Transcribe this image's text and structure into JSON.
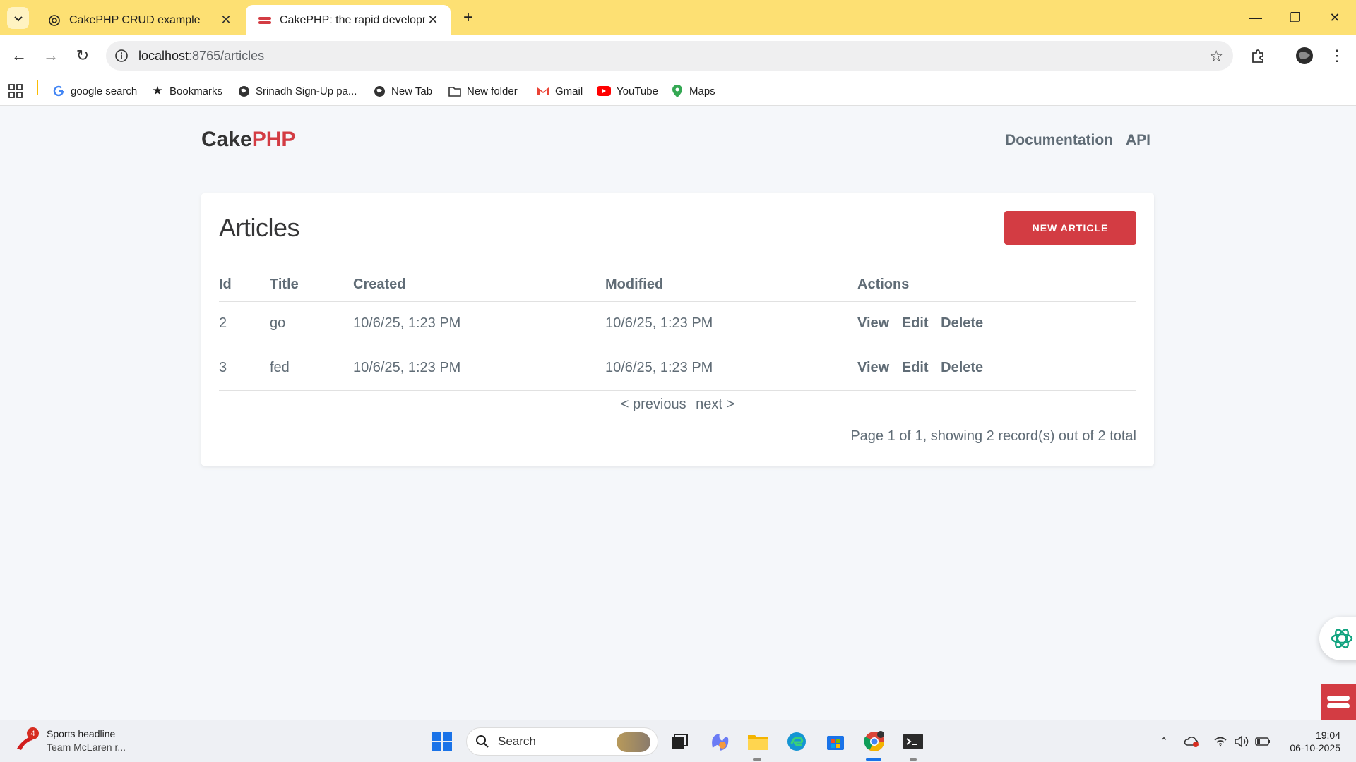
{
  "browser": {
    "tabs": [
      {
        "title": "CakePHP CRUD example",
        "active": false
      },
      {
        "title": "CakePHP: the rapid developme",
        "active": true
      }
    ],
    "url_host": "localhost",
    "url_path": ":8765/articles",
    "bookmarks": [
      {
        "label": "google search",
        "icon": "google-icon"
      },
      {
        "label": "Bookmarks",
        "icon": "star-icon"
      },
      {
        "label": "Srinadh Sign-Up pa...",
        "icon": "globe-icon"
      },
      {
        "label": "New Tab",
        "icon": "globe-icon"
      },
      {
        "label": "New folder",
        "icon": "folder-icon"
      },
      {
        "label": "Gmail",
        "icon": "gmail-icon"
      },
      {
        "label": "YouTube",
        "icon": "youtube-icon"
      },
      {
        "label": "Maps",
        "icon": "maps-icon"
      }
    ]
  },
  "site": {
    "brand_prefix": "Cake",
    "brand_suffix": "PHP",
    "nav": [
      "Documentation",
      "API"
    ],
    "brand_color": "#d33c43"
  },
  "articles": {
    "heading": "Articles",
    "new_button": "NEW ARTICLE",
    "columns": [
      "Id",
      "Title",
      "Created",
      "Modified",
      "Actions"
    ],
    "rows": [
      {
        "id": "2",
        "title": "go",
        "created": "10/6/25, 1:23 PM",
        "modified": "10/6/25, 1:23 PM"
      },
      {
        "id": "3",
        "title": "fed",
        "created": "10/6/25, 1:23 PM",
        "modified": "10/6/25, 1:23 PM"
      }
    ],
    "actions": [
      "View",
      "Edit",
      "Delete"
    ],
    "prev": "< previous",
    "next": "next >",
    "counter": "Page 1 of 1, showing 2 record(s) out of 2 total"
  },
  "taskbar": {
    "news_badge": "4",
    "news_title": "Sports headline",
    "news_sub": "Team McLaren r...",
    "search_placeholder": "Search",
    "time": "19:04",
    "date": "06-10-2025"
  }
}
